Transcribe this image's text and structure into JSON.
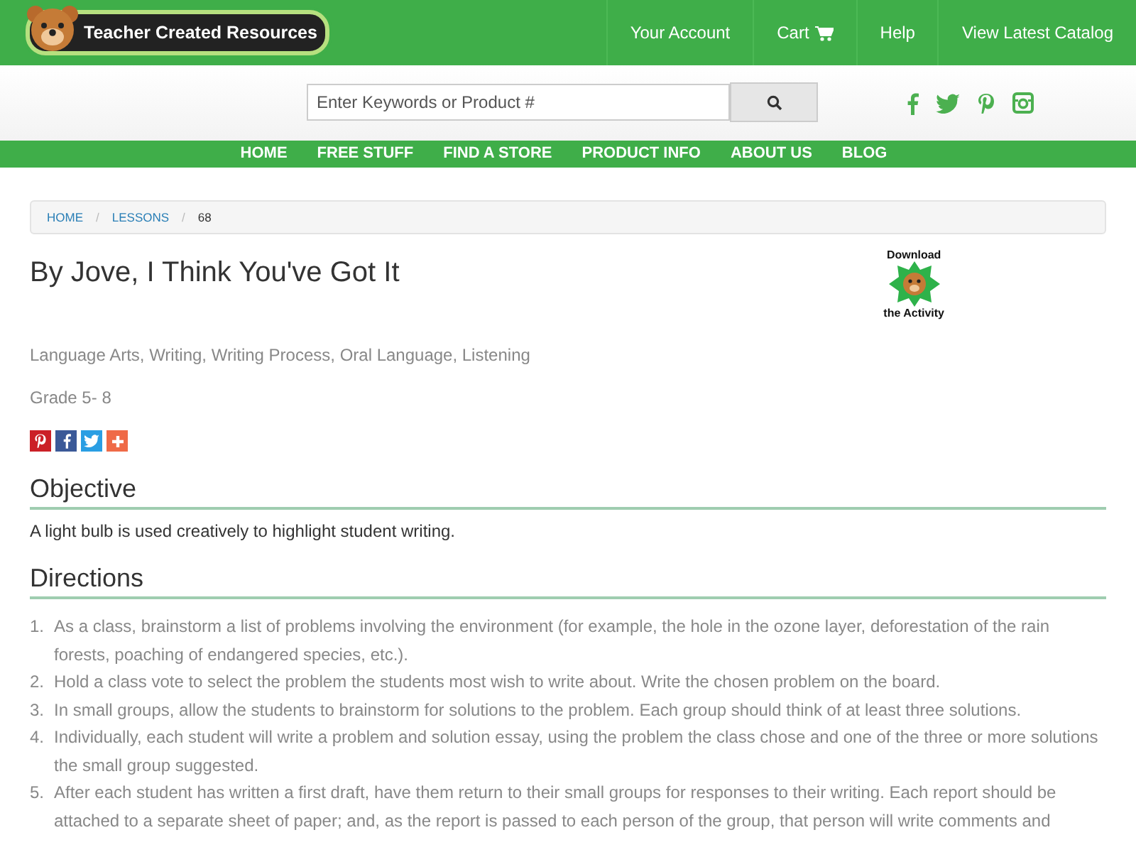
{
  "header": {
    "logo_text": "Teacher Created Resources",
    "links": [
      {
        "label": "Your Account",
        "kind": "text"
      },
      {
        "label": "Cart",
        "kind": "cart"
      },
      {
        "label": "Help",
        "kind": "text"
      },
      {
        "label": "View Latest Catalog",
        "kind": "text"
      }
    ]
  },
  "search": {
    "placeholder": "Enter Keywords or Product #"
  },
  "social": [
    {
      "kind": "facebook"
    },
    {
      "kind": "twitter"
    },
    {
      "kind": "pinterest"
    },
    {
      "kind": "instagram"
    }
  ],
  "nav": [
    "HOME",
    "FREE STUFF",
    "FIND A STORE",
    "PRODUCT INFO",
    "ABOUT US",
    "BLOG"
  ],
  "breadcrumb": {
    "separator": "/",
    "items": [
      {
        "label": "HOME",
        "link": true
      },
      {
        "label": "LESSONS",
        "link": true
      },
      {
        "label": "68",
        "link": false
      }
    ]
  },
  "title": "By Jove, I Think You've Got It",
  "badge": {
    "top": "Download",
    "bottom": "the Activity"
  },
  "subjects": "Language Arts, Writing, Writing Process, Oral Language, Listening",
  "grade": "Grade 5- 8",
  "share": [
    {
      "kind": "pinterest",
      "color": "#cb2027"
    },
    {
      "kind": "facebook",
      "color": "#3b5998"
    },
    {
      "kind": "twitter",
      "color": "#2a9ee3"
    },
    {
      "kind": "plus",
      "color": "#ef6a47"
    }
  ],
  "objective": {
    "heading": "Objective",
    "text": "A light bulb is used creatively to highlight student writing."
  },
  "directions": {
    "heading": "Directions",
    "steps": [
      {
        "number": "1.",
        "text": "As a class, brainstorm a list of problems involving the environment (for example, the hole in the ozone layer, deforestation of the rain forests, poaching of endangered species, etc.)."
      },
      {
        "number": "2.",
        "text": "Hold a class vote to select the problem the students most wish to write about. Write the chosen problem on the board."
      },
      {
        "number": "3.",
        "text": "In small groups, allow the students to brainstorm for solutions to the problem. Each group should think of at least three solutions."
      },
      {
        "number": "4.",
        "text": "Individually, each student will write a problem and solution essay, using the problem the class chose and one of the three or more solutions the small group suggested."
      },
      {
        "number": "5.",
        "text": "After each student has written a first draft, have them return to their small groups for responses to their writing. Each report should be attached to a separate sheet of paper; and, as the report is passed to each person of the group, that person will write comments and"
      }
    ]
  }
}
